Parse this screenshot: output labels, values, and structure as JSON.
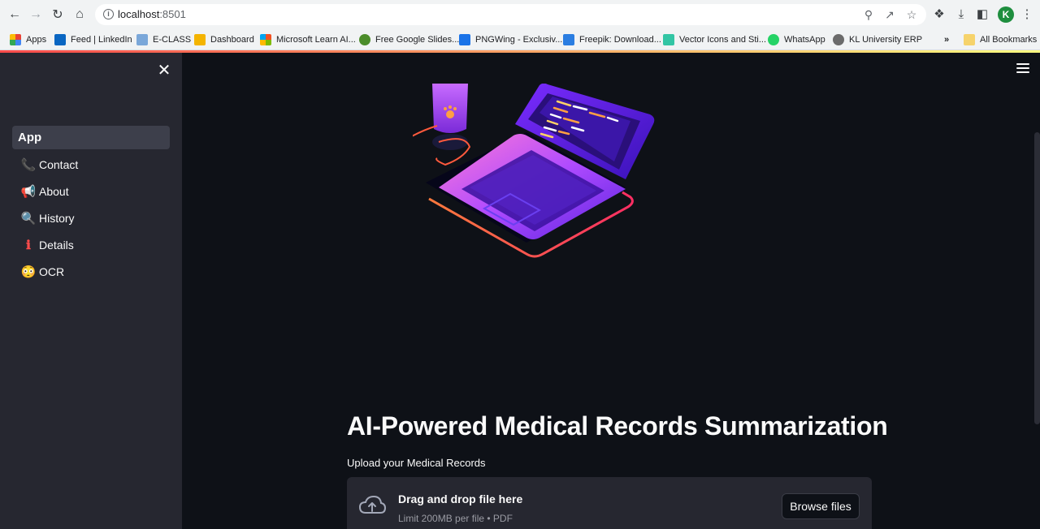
{
  "browser": {
    "url_host": "localhost",
    "url_port": ":8501",
    "avatar_letter": "K",
    "bookmarks": [
      {
        "label": "Apps",
        "color": "#ea4335"
      },
      {
        "label": "Feed | LinkedIn",
        "color": "#0a66c2"
      },
      {
        "label": "E-CLASS",
        "color": "#7aa7d9"
      },
      {
        "label": "Dashboard",
        "color": "#f4b400"
      },
      {
        "label": "Microsoft Learn AI...",
        "color": "#f25022"
      },
      {
        "label": "Free Google Slides...",
        "color": "#4c8d2b"
      },
      {
        "label": "PNGWing - Exclusiv...",
        "color": "#1a73e8"
      },
      {
        "label": "Freepik: Download...",
        "color": "#2a7de1"
      },
      {
        "label": "Vector Icons and Sti...",
        "color": "#32c5a4"
      },
      {
        "label": "WhatsApp",
        "color": "#25d366"
      },
      {
        "label": "KL University ERP",
        "color": "#6b6b6b"
      }
    ],
    "overflow_label": "»",
    "all_bookmarks_label": "All Bookmarks"
  },
  "sidebar": {
    "items": [
      {
        "emoji": "",
        "label": "App",
        "active": true
      },
      {
        "emoji": "📞",
        "label": "Contact"
      },
      {
        "emoji": "📢",
        "label": "About"
      },
      {
        "emoji": "🔍",
        "label": "History"
      },
      {
        "emoji": "ℹ",
        "label": "Details"
      },
      {
        "emoji": "😳",
        "label": "OCR"
      }
    ]
  },
  "main": {
    "title": "AI-Powered Medical Records Summarization",
    "upload_label": "Upload your Medical Records",
    "dropzone": {
      "title": "Drag and drop file here",
      "subtitle": "Limit 200MB per file • PDF",
      "button": "Browse files"
    }
  },
  "colors": {
    "app_bg": "#0e1117",
    "sidebar_bg": "#262730",
    "accent": "#ff4b4b"
  }
}
